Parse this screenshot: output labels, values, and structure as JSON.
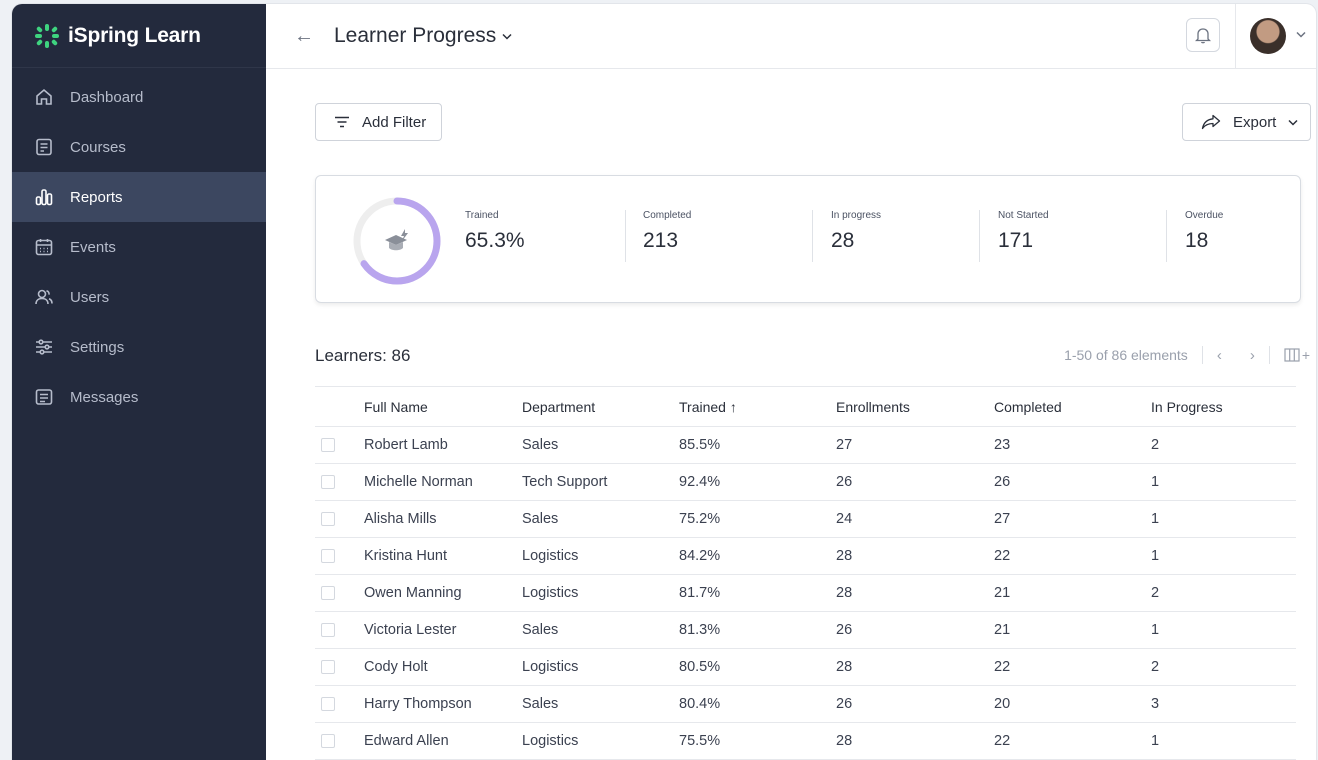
{
  "app": {
    "brand": "iSpring Learn",
    "brand_color": "#3ed37f"
  },
  "sidebar": {
    "items": [
      {
        "label": "Dashboard",
        "icon": "home-icon",
        "active": false
      },
      {
        "label": "Courses",
        "icon": "courses-icon",
        "active": false
      },
      {
        "label": "Reports",
        "icon": "bar-chart-icon",
        "active": true
      },
      {
        "label": "Events",
        "icon": "calendar-icon",
        "active": false
      },
      {
        "label": "Users",
        "icon": "users-icon",
        "active": false
      },
      {
        "label": "Settings",
        "icon": "sliders-icon",
        "active": false
      },
      {
        "label": "Messages",
        "icon": "message-icon",
        "active": false
      }
    ]
  },
  "header": {
    "back_icon": "←",
    "title": "Learner Progress",
    "title_chevron": "⌄",
    "avatar_chevron": "⌄"
  },
  "toolbar": {
    "filter_label": "Add Filter",
    "export_label": "Export"
  },
  "stats": {
    "trained": {
      "label": "Trained",
      "value": "65.3%",
      "fraction": 0.653
    },
    "completed": {
      "label": "Completed",
      "value": "213"
    },
    "in_progress": {
      "label": "In progress",
      "value": "28"
    },
    "not_started": {
      "label": "Not Started",
      "value": "171"
    },
    "overdue": {
      "label": "Overdue",
      "value": "18"
    },
    "accent_color": "#b9a5ee"
  },
  "learners": {
    "heading": "Learners: 86",
    "pager_text": "1-50 of 86 elements",
    "prev": "‹",
    "next": "›",
    "columns_plus": "+",
    "headers": {
      "name": "Full Name",
      "dept": "Department",
      "trained": "Trained ↑",
      "enrollments": "Enrollments",
      "completed": "Completed",
      "in_progress": "In Progress"
    },
    "rows": [
      {
        "name": "Robert Lamb",
        "dept": "Sales",
        "trained": "85.5%",
        "enrollments": "27",
        "completed": "23",
        "in_progress": "2"
      },
      {
        "name": "Michelle Norman",
        "dept": "Tech Support",
        "trained": "92.4%",
        "enrollments": "26",
        "completed": "26",
        "in_progress": "1"
      },
      {
        "name": "Alisha Mills",
        "dept": "Sales",
        "trained": "75.2%",
        "enrollments": "24",
        "completed": "27",
        "in_progress": "1"
      },
      {
        "name": "Kristina Hunt",
        "dept": "Logistics",
        "trained": "84.2%",
        "enrollments": "28",
        "completed": "22",
        "in_progress": "1"
      },
      {
        "name": "Owen Manning",
        "dept": "Logistics",
        "trained": "81.7%",
        "enrollments": "28",
        "completed": "21",
        "in_progress": "2"
      },
      {
        "name": "Victoria Lester",
        "dept": "Sales",
        "trained": "81.3%",
        "enrollments": "26",
        "completed": "21",
        "in_progress": "1"
      },
      {
        "name": "Cody Holt",
        "dept": "Logistics",
        "trained": "80.5%",
        "enrollments": "28",
        "completed": "22",
        "in_progress": "2"
      },
      {
        "name": "Harry Thompson",
        "dept": "Sales",
        "trained": "80.4%",
        "enrollments": "26",
        "completed": "20",
        "in_progress": "3"
      },
      {
        "name": "Edward Allen",
        "dept": "Logistics",
        "trained": "75.5%",
        "enrollments": "28",
        "completed": "22",
        "in_progress": "1"
      }
    ]
  }
}
